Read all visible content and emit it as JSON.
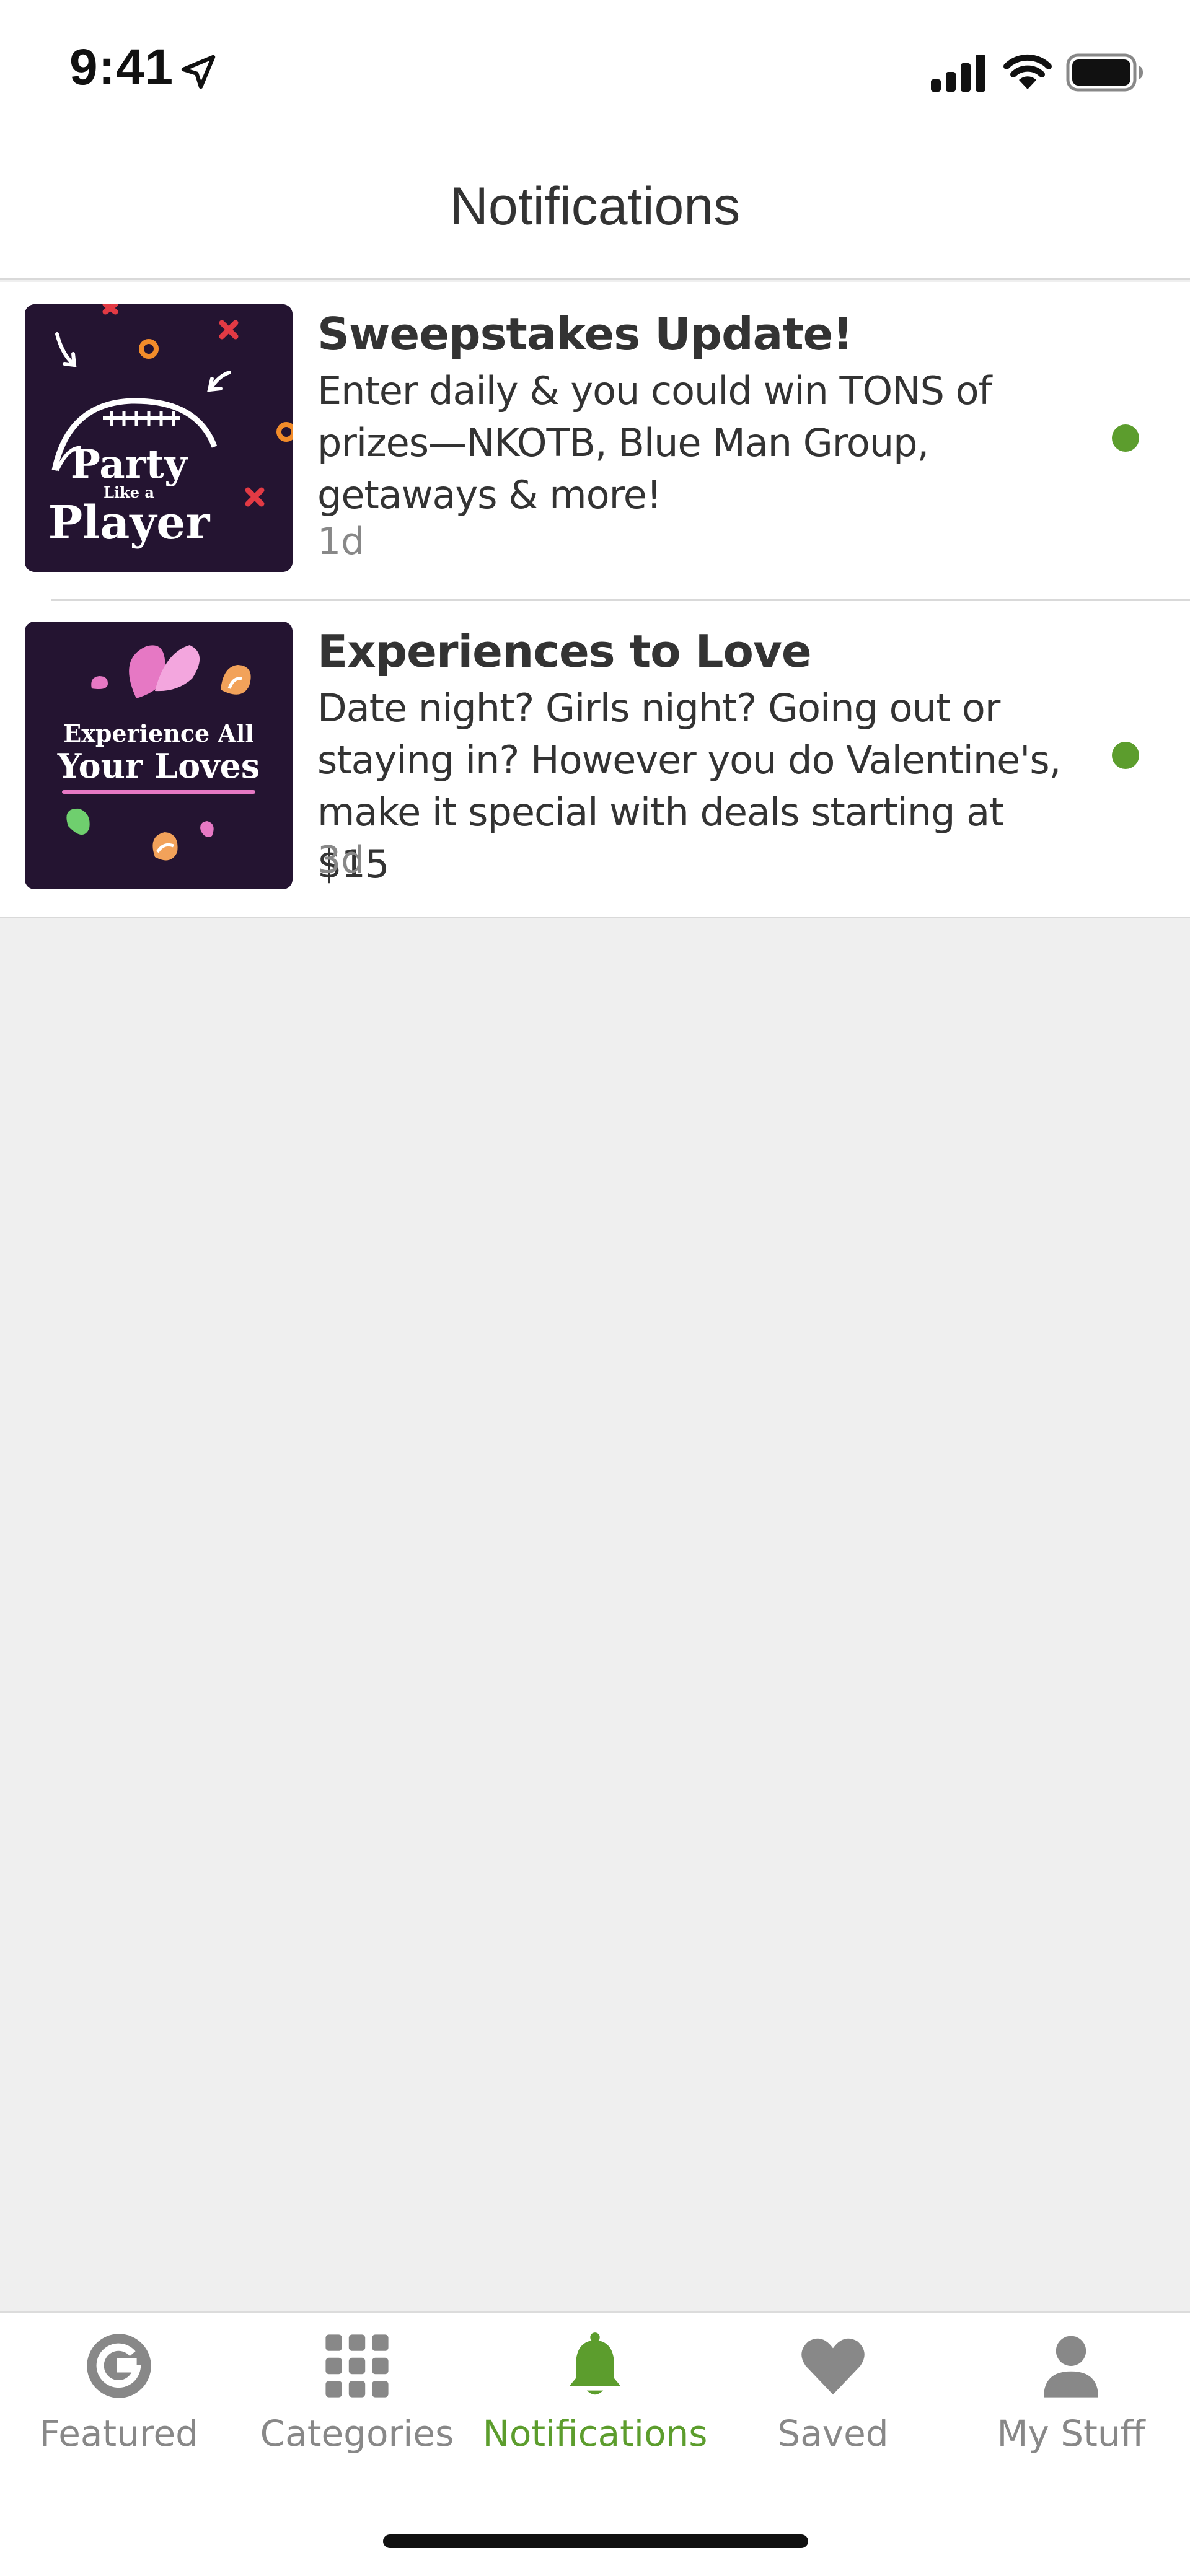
{
  "status_bar": {
    "time": "9:41"
  },
  "header": {
    "title": "Notifications"
  },
  "notifications": [
    {
      "title": "Sweepstakes Update!",
      "body": "Enter daily & you could win TONS of prizes—NKOTB, Blue Man Group, getaways & more!",
      "time": "1d",
      "unread": true,
      "thumb_text": {
        "line1": "Party",
        "line2": "Like a",
        "line3": "Player"
      }
    },
    {
      "title": "Experiences to Love",
      "body": "Date night? Girls night? Going out or staying in? However you do Valentine's, make it special with deals starting at $15",
      "time": "3d",
      "unread": true,
      "thumb_text": {
        "line1": "Experience All",
        "line2": "Your Loves"
      }
    }
  ],
  "tabs": [
    {
      "label": "Featured",
      "icon": "g-logo-icon",
      "active": false
    },
    {
      "label": "Categories",
      "icon": "grid-icon",
      "active": false
    },
    {
      "label": "Notifications",
      "icon": "bell-icon",
      "active": true
    },
    {
      "label": "Saved",
      "icon": "heart-icon",
      "active": false
    },
    {
      "label": "My Stuff",
      "icon": "person-icon",
      "active": false
    }
  ],
  "colors": {
    "accent": "#5c9d2d",
    "thumb_bg": "#241431",
    "inactive_tab": "#888888"
  }
}
